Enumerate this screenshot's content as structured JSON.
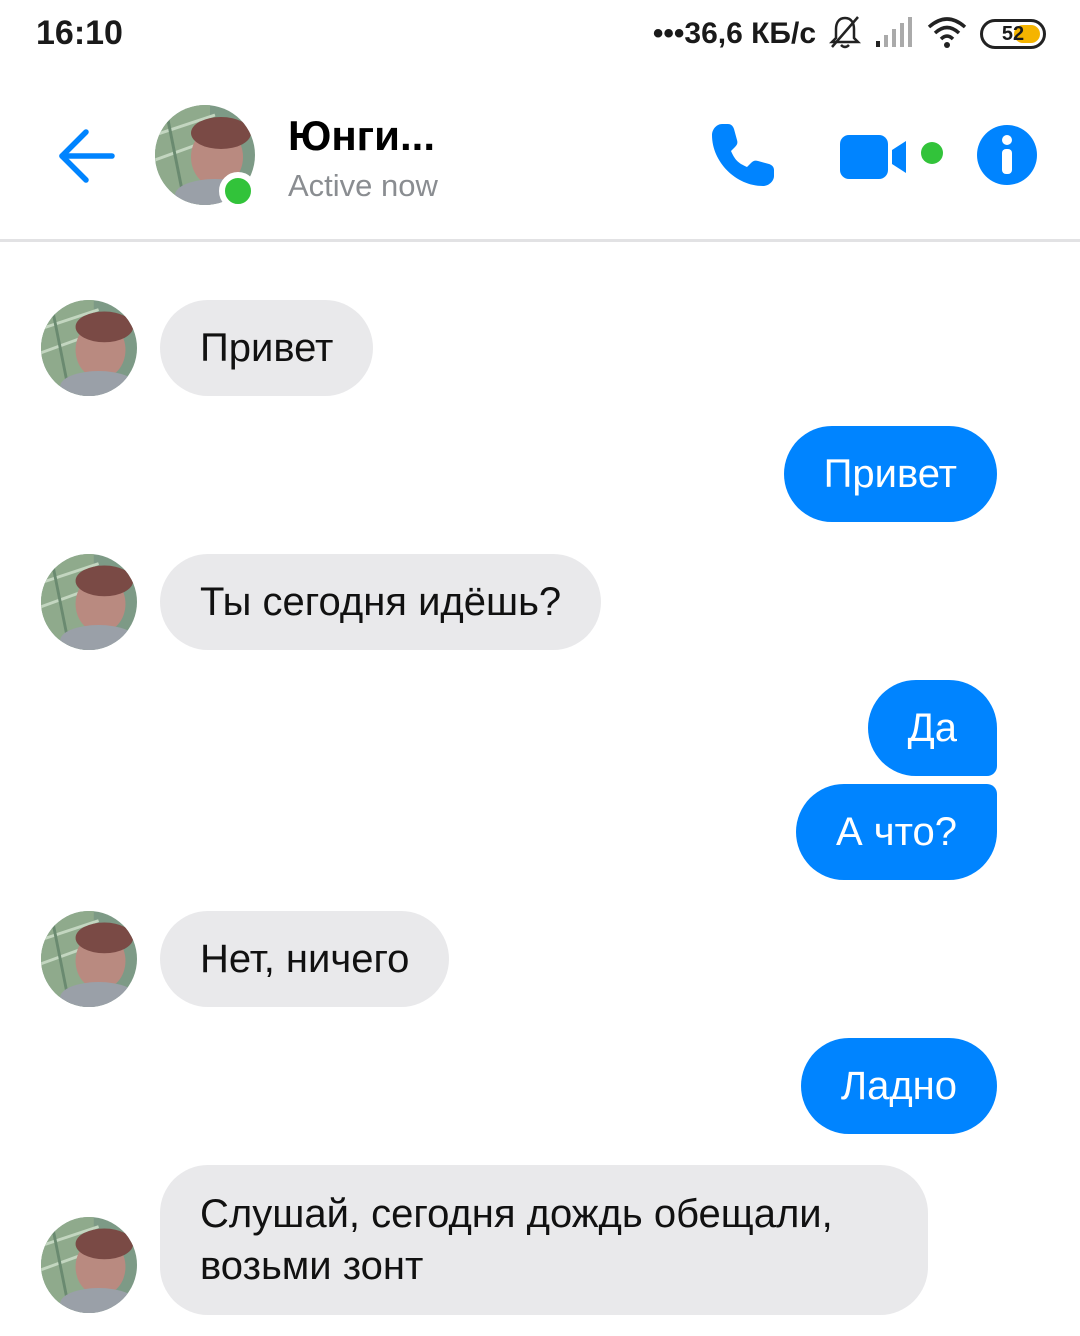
{
  "status_bar": {
    "time": "16:10",
    "network_speed": "•••36,6 КБ/с",
    "battery_level": "52",
    "icons": [
      "bell-off-icon",
      "signal-icon",
      "wifi-icon",
      "battery-icon"
    ]
  },
  "header": {
    "contact_name": "Юнги...",
    "contact_status": "Active now",
    "icons": [
      "back-arrow-icon",
      "phone-icon",
      "video-camera-icon",
      "info-icon"
    ],
    "accent_color": "#0084ff",
    "online_color": "#32c33a"
  },
  "messages": [
    {
      "direction": "incoming",
      "text": "Привет"
    },
    {
      "direction": "outgoing",
      "text": "Привет"
    },
    {
      "direction": "incoming",
      "text": "Ты сегодня идёшь?"
    },
    {
      "direction": "outgoing",
      "text": "Да"
    },
    {
      "direction": "outgoing",
      "text": "А что?"
    },
    {
      "direction": "incoming",
      "text": "Нет, ничего"
    },
    {
      "direction": "outgoing",
      "text": "Ладно"
    },
    {
      "direction": "incoming",
      "text": "Слушай, сегодня дождь обещали, возьми зонт"
    }
  ],
  "colors": {
    "incoming_bubble": "#e9e9eb",
    "outgoing_bubble": "#0084ff"
  }
}
